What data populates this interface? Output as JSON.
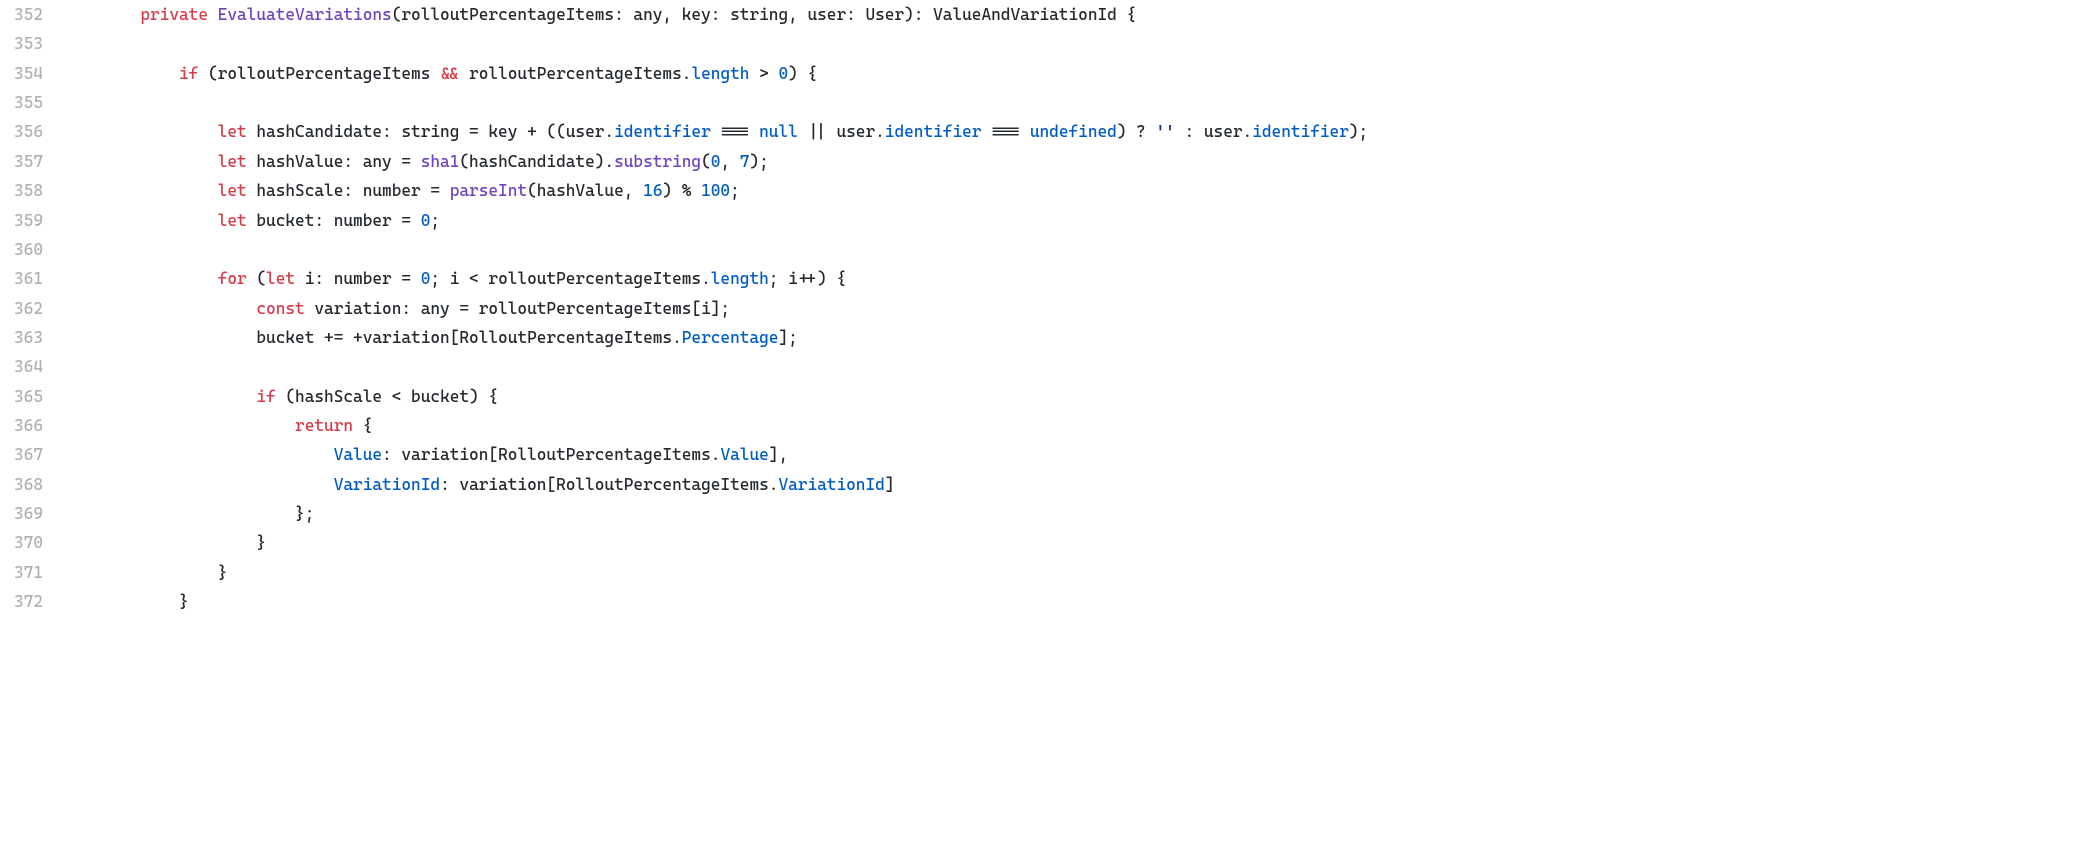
{
  "lines": [
    {
      "num": "352",
      "indent": 2,
      "tokens": [
        {
          "t": "private ",
          "c": "kw-private"
        },
        {
          "t": "EvaluateVariations",
          "c": "fn-name"
        },
        {
          "t": "(rolloutPercentageItems: any, key: string, user: User): ValueAndVariationId {",
          "c": "ident"
        }
      ]
    },
    {
      "num": "353",
      "indent": 0,
      "tokens": []
    },
    {
      "num": "354",
      "indent": 3,
      "tokens": [
        {
          "t": "if ",
          "c": "kw-if"
        },
        {
          "t": "(rolloutPercentageItems ",
          "c": "ident"
        },
        {
          "t": "&&",
          "c": "kw-private"
        },
        {
          "t": " rolloutPercentageItems.",
          "c": "ident"
        },
        {
          "t": "length",
          "c": "prop"
        },
        {
          "t": " > ",
          "c": "ident"
        },
        {
          "t": "0",
          "c": "num"
        },
        {
          "t": ") {",
          "c": "ident"
        }
      ]
    },
    {
      "num": "355",
      "indent": 0,
      "tokens": []
    },
    {
      "num": "356",
      "indent": 4,
      "tokens": [
        {
          "t": "let ",
          "c": "kw-let"
        },
        {
          "t": "hashCandidate: string = key + ((user.",
          "c": "ident"
        },
        {
          "t": "identifier",
          "c": "prop"
        },
        {
          "t": " === ",
          "c": "ident"
        },
        {
          "t": "null",
          "c": "const-val"
        },
        {
          "t": " || user.",
          "c": "ident"
        },
        {
          "t": "identifier",
          "c": "prop"
        },
        {
          "t": " === ",
          "c": "ident"
        },
        {
          "t": "undefined",
          "c": "const-val"
        },
        {
          "t": ") ? ",
          "c": "ident"
        },
        {
          "t": "''",
          "c": "str"
        },
        {
          "t": " : user.",
          "c": "ident"
        },
        {
          "t": "identifier",
          "c": "prop"
        },
        {
          "t": ");",
          "c": "ident"
        }
      ]
    },
    {
      "num": "357",
      "indent": 4,
      "tokens": [
        {
          "t": "let ",
          "c": "kw-let"
        },
        {
          "t": "hashValue: any = ",
          "c": "ident"
        },
        {
          "t": "sha1",
          "c": "fn-name"
        },
        {
          "t": "(hashCandidate).",
          "c": "ident"
        },
        {
          "t": "substring",
          "c": "fn-name"
        },
        {
          "t": "(",
          "c": "ident"
        },
        {
          "t": "0",
          "c": "num"
        },
        {
          "t": ", ",
          "c": "ident"
        },
        {
          "t": "7",
          "c": "num"
        },
        {
          "t": ");",
          "c": "ident"
        }
      ]
    },
    {
      "num": "358",
      "indent": 4,
      "tokens": [
        {
          "t": "let ",
          "c": "kw-let"
        },
        {
          "t": "hashScale: number = ",
          "c": "ident"
        },
        {
          "t": "parseInt",
          "c": "fn-name"
        },
        {
          "t": "(hashValue, ",
          "c": "ident"
        },
        {
          "t": "16",
          "c": "num"
        },
        {
          "t": ") % ",
          "c": "ident"
        },
        {
          "t": "100",
          "c": "num"
        },
        {
          "t": ";",
          "c": "ident"
        }
      ]
    },
    {
      "num": "359",
      "indent": 4,
      "tokens": [
        {
          "t": "let ",
          "c": "kw-let"
        },
        {
          "t": "bucket: number = ",
          "c": "ident"
        },
        {
          "t": "0",
          "c": "num"
        },
        {
          "t": ";",
          "c": "ident"
        }
      ]
    },
    {
      "num": "360",
      "indent": 0,
      "tokens": []
    },
    {
      "num": "361",
      "indent": 4,
      "tokens": [
        {
          "t": "for ",
          "c": "kw-for"
        },
        {
          "t": "(",
          "c": "ident"
        },
        {
          "t": "let ",
          "c": "kw-let"
        },
        {
          "t": "i: number = ",
          "c": "ident"
        },
        {
          "t": "0",
          "c": "num"
        },
        {
          "t": "; i < rolloutPercentageItems.",
          "c": "ident"
        },
        {
          "t": "length",
          "c": "prop"
        },
        {
          "t": "; i++) {",
          "c": "ident"
        }
      ]
    },
    {
      "num": "362",
      "indent": 5,
      "tokens": [
        {
          "t": "const ",
          "c": "kw-const"
        },
        {
          "t": "variation: any = rolloutPercentageItems[i];",
          "c": "ident"
        }
      ]
    },
    {
      "num": "363",
      "indent": 5,
      "tokens": [
        {
          "t": "bucket += +variation[RolloutPercentageItems.",
          "c": "ident"
        },
        {
          "t": "Percentage",
          "c": "prop"
        },
        {
          "t": "];",
          "c": "ident"
        }
      ]
    },
    {
      "num": "364",
      "indent": 0,
      "tokens": []
    },
    {
      "num": "365",
      "indent": 5,
      "tokens": [
        {
          "t": "if ",
          "c": "kw-if"
        },
        {
          "t": "(hashScale < bucket) {",
          "c": "ident"
        }
      ]
    },
    {
      "num": "366",
      "indent": 6,
      "tokens": [
        {
          "t": "return ",
          "c": "kw-return"
        },
        {
          "t": "{",
          "c": "ident"
        }
      ]
    },
    {
      "num": "367",
      "indent": 7,
      "tokens": [
        {
          "t": "Value",
          "c": "prop"
        },
        {
          "t": ": variation[RolloutPercentageItems.",
          "c": "ident"
        },
        {
          "t": "Value",
          "c": "prop"
        },
        {
          "t": "],",
          "c": "ident"
        }
      ]
    },
    {
      "num": "368",
      "indent": 7,
      "tokens": [
        {
          "t": "VariationId",
          "c": "prop"
        },
        {
          "t": ": variation[RolloutPercentageItems.",
          "c": "ident"
        },
        {
          "t": "VariationId",
          "c": "prop"
        },
        {
          "t": "]",
          "c": "ident"
        }
      ]
    },
    {
      "num": "369",
      "indent": 6,
      "tokens": [
        {
          "t": "};",
          "c": "ident"
        }
      ]
    },
    {
      "num": "370",
      "indent": 5,
      "tokens": [
        {
          "t": "}",
          "c": "ident"
        }
      ]
    },
    {
      "num": "371",
      "indent": 4,
      "tokens": [
        {
          "t": "}",
          "c": "ident"
        }
      ]
    },
    {
      "num": "372",
      "indent": 3,
      "tokens": [
        {
          "t": "}",
          "c": "ident"
        }
      ]
    }
  ]
}
